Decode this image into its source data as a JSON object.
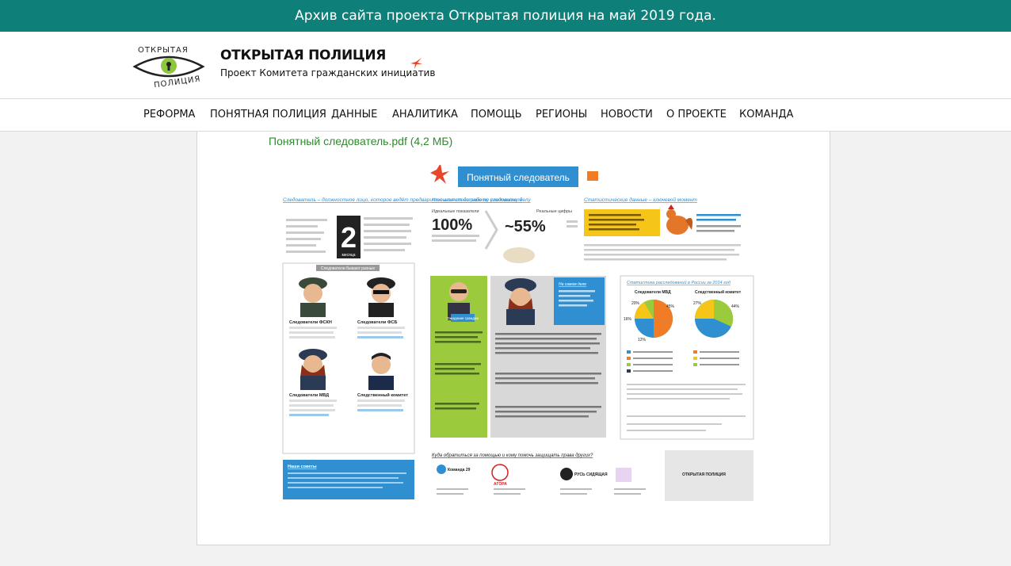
{
  "banner": {
    "text": "Архив сайта проекта Открытая полиция на май 2019 года."
  },
  "header": {
    "logo_alt": "ОТКРЫТАЯ ПОЛИЦИЯ",
    "title": "ОТКРЫТАЯ ПОЛИЦИЯ",
    "subtitle": "Проект Комитета гражданских инициатив"
  },
  "nav": {
    "items": [
      {
        "label": "РЕФОРМА"
      },
      {
        "label": "ПОНЯТНАЯ ПОЛИЦИЯ"
      },
      {
        "label": "ДАННЫЕ"
      },
      {
        "label": "АНАЛИТИКА"
      },
      {
        "label": "ПОМОЩЬ"
      },
      {
        "label": "РЕГИОНЫ"
      },
      {
        "label": "НОВОСТИ"
      },
      {
        "label": "О ПРОЕКТЕ"
      },
      {
        "label": "КОМАНДА"
      }
    ]
  },
  "main": {
    "pdf_link": "Понятный следователь.pdf (4,2 МБ)",
    "poster": {
      "title": "Понятный следователь",
      "sec1_title": "Следователь – должностное лицо, которое ведёт предварительное следствие по уголовному делу",
      "sec2_title": "Что влияет на работу следователя",
      "sec3_title": "Статистические данные – ключевой момент",
      "ideal_label": "Идеальные показатели",
      "ideal_value": "100%",
      "real_label": "Реальные цифры",
      "real_value": "~55%",
      "big_number": "2",
      "big_number_unit": "месяца",
      "types_header": "Следователи бывают разные",
      "investigator_types": [
        {
          "name": "Следователи ФСКН"
        },
        {
          "name": "Следователи ФСБ"
        },
        {
          "name": "Следователи МВД"
        },
        {
          "name": "Следственный комитет"
        }
      ],
      "expect_label": "Ожидание граждан",
      "real_case_label": "На самом деле",
      "stats_title": "Статистика расследований в России за 2014 год",
      "pie_left_title": "Следователи МВД",
      "pie_right_title": "Следственный комитет",
      "help_question": "Куда обратиться за помощью и кому помочь защищать права других?",
      "help_box_title": "Наши советы",
      "orgs": [
        {
          "name": "Команда 29"
        },
        {
          "name": "АГОРА"
        },
        {
          "name": "РУСЬ СИДЯЩАЯ"
        },
        {
          "name": "ОТКРЫТАЯ ПОЛИЦИЯ"
        }
      ],
      "pct_45": "45%",
      "pct_20": "20%",
      "pct_16": "16%",
      "pct_12": "12%",
      "pct_44": "44%",
      "pct_27": "27%"
    }
  },
  "colors": {
    "banner_bg": "#0e8079",
    "link_green": "#2e8b2e",
    "poster_blue": "#2f8fd0",
    "poster_orange": "#f07d26",
    "poster_yellow": "#f5c518",
    "poster_green": "#9bcb3c"
  }
}
